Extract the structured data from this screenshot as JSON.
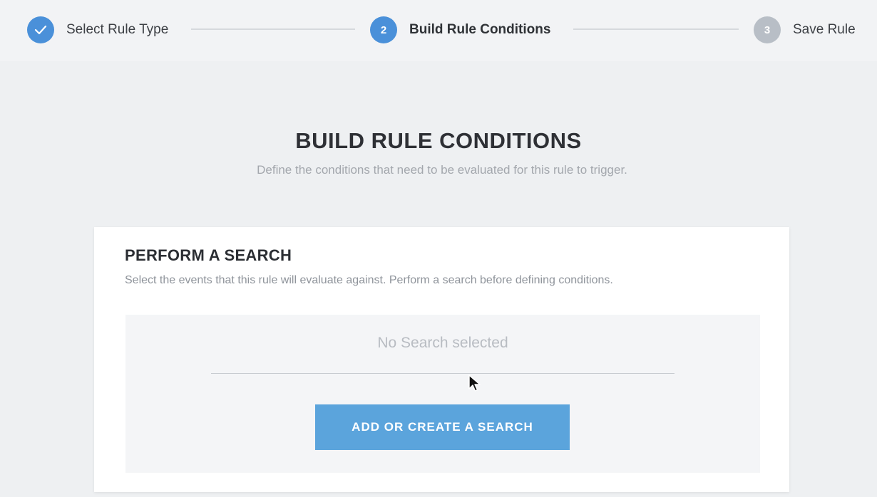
{
  "stepper": {
    "steps": [
      {
        "label": "Select Rule Type",
        "status": "completed",
        "icon": "check-icon"
      },
      {
        "label": "Build Rule Conditions",
        "number": "2",
        "status": "active"
      },
      {
        "label": "Save Rule",
        "number": "3",
        "status": "pending"
      }
    ]
  },
  "header": {
    "title": "BUILD RULE CONDITIONS",
    "subtitle": "Define the conditions that need to be evaluated for this rule to trigger."
  },
  "search_card": {
    "title": "PERFORM A SEARCH",
    "description": "Select the events that this rule will evaluate against. Perform a search before defining conditions.",
    "selected_search_placeholder": "No Search selected",
    "button_label": "ADD OR CREATE A SEARCH"
  },
  "colors": {
    "accent": "#4a90d9",
    "button": "#5ba4dc",
    "pending": "#b8bec6",
    "background": "#eef0f2"
  }
}
